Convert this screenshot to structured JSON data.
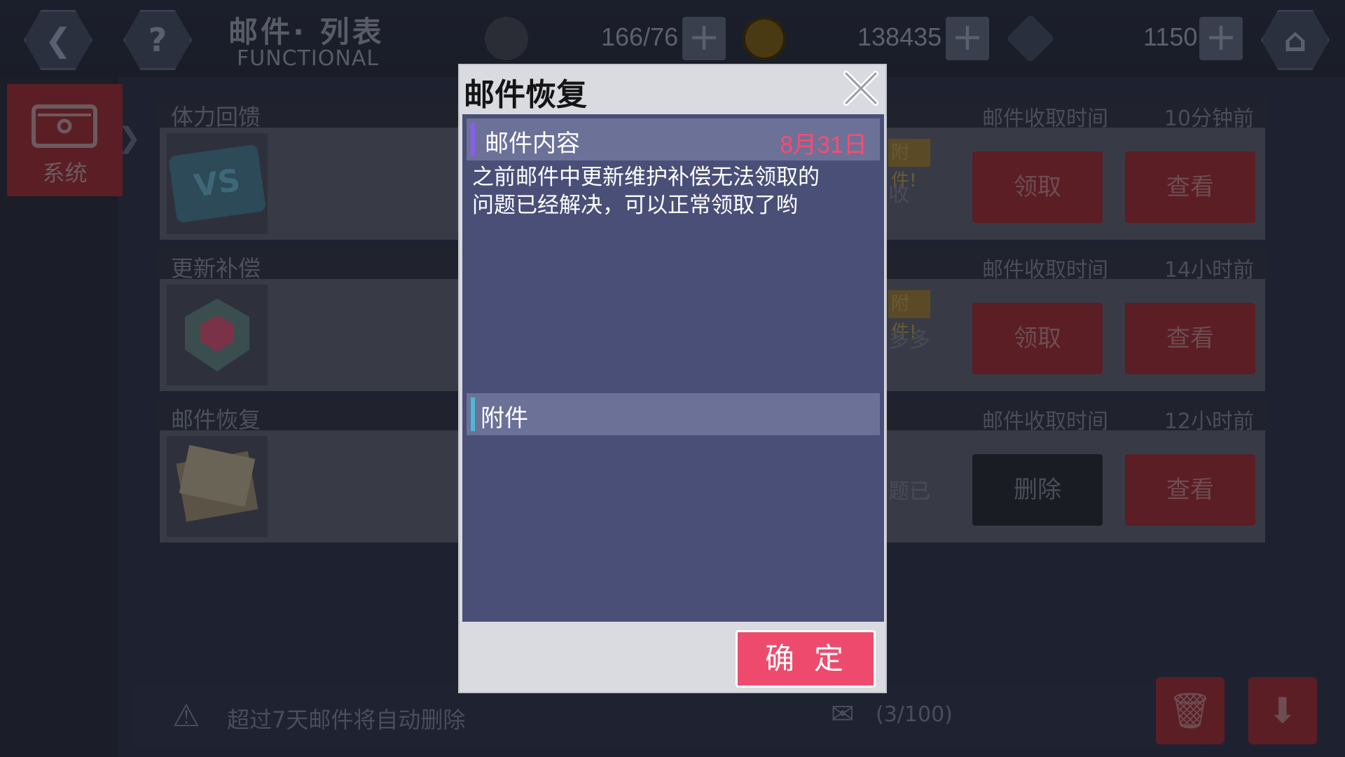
{
  "header": {
    "title_cn": "邮件· 列表",
    "title_en": "FUNCTIONAL",
    "stamina": "166/76",
    "coins": "138435",
    "gems": "1150"
  },
  "sidebar": {
    "tab_label": "系统"
  },
  "mails": [
    {
      "type": "体力回馈",
      "time_label": "邮件收取时间",
      "time": "10分钟前",
      "tag": "附件!",
      "snippet": "收",
      "btn_left": "领取",
      "btn_right": "查看"
    },
    {
      "type": "更新补偿",
      "time_label": "邮件收取时间",
      "time": "14小时前",
      "tag": "附件!",
      "snippet": "多多",
      "btn_left": "领取",
      "btn_right": "查看"
    },
    {
      "type": "邮件恢复",
      "time_label": "邮件收取时间",
      "time": "12小时前",
      "tag": "",
      "snippet": "题已",
      "btn_left": "删除",
      "btn_right": "查看"
    }
  ],
  "footer": {
    "notice": "超过7天邮件将自动删除",
    "count": "(3/100)"
  },
  "modal": {
    "title": "邮件恢复",
    "content_header": "邮件内容",
    "date": "8月31日",
    "content_line1": "之前邮件中更新维护补偿无法领取的",
    "content_line2": "问题已经解决，可以正常领取了哟",
    "attachment_header": "附件",
    "confirm": "确定"
  },
  "colors": {
    "accent_pink": "#ee4a6e",
    "date_red": "#ff4a6e",
    "panel_blue": "#4a4f78",
    "header_blue": "#6c7198",
    "bar_purple": "#8a5cf0",
    "bar_cyan": "#4ab8d8"
  }
}
